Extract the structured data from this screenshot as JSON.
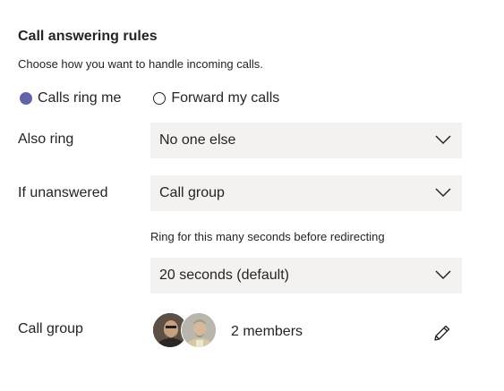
{
  "header": {
    "title": "Call answering rules",
    "subtitle": "Choose how you want to handle incoming calls."
  },
  "answer_mode": {
    "options": [
      {
        "label": "Calls ring me",
        "selected": true
      },
      {
        "label": "Forward my calls",
        "selected": false
      }
    ]
  },
  "also_ring": {
    "label": "Also ring",
    "value": "No one else"
  },
  "if_unanswered": {
    "label": "If unanswered",
    "value": "Call group"
  },
  "ring_duration": {
    "helper": "Ring for this many seconds before redirecting",
    "value": "20 seconds (default)"
  },
  "call_group": {
    "label": "Call group",
    "members_text": "2 members"
  },
  "icons": {
    "dropdown": "chevron-down-icon",
    "edit": "pencil-icon"
  },
  "colors": {
    "accent": "#6264a7",
    "field_background": "#f3f2f1",
    "text": "#252423"
  }
}
